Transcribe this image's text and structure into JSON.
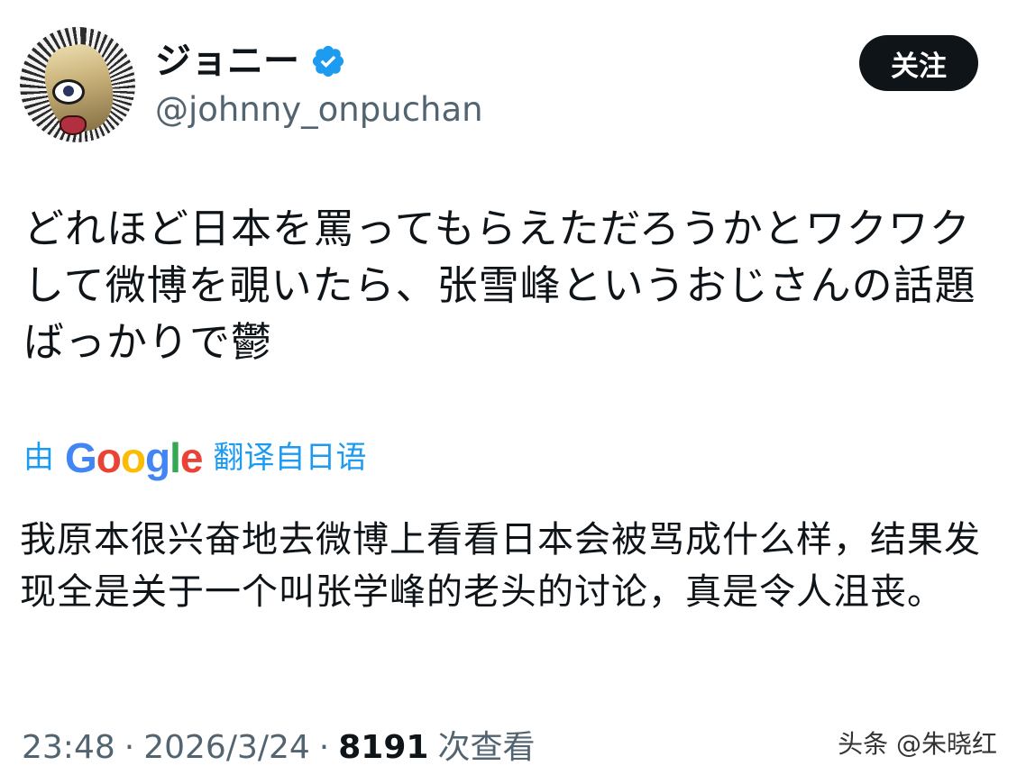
{
  "author": {
    "display_name": "ジョニー",
    "handle": "@johnny_onpuchan",
    "verified": true,
    "avatar": "avatar-image"
  },
  "follow_button": {
    "label": "关注"
  },
  "tweet": {
    "text": "どれほど日本を罵ってもらえただろうかとワクワクして微博を覗いたら、张雪峰というおじさんの話題ばっかりで鬱"
  },
  "translation": {
    "prefix": "由",
    "brand": "Google",
    "suffix": "翻译自日语",
    "text": "我原本很兴奋地去微博上看看日本会被骂成什么样，结果发现全是关于一个叫张学峰的老头的讨论，真是令人沮丧。"
  },
  "meta": {
    "time": "23:48",
    "separator": "·",
    "date": "2026/3/24",
    "views_count": "8191",
    "views_label": "次查看"
  },
  "watermark": {
    "text": "头条 @朱晓红"
  },
  "icons": {
    "verified": "verified-badge-icon"
  },
  "colors": {
    "accent": "#1d9bf0",
    "follow_bg": "#0f1419",
    "secondary_text": "#536471"
  }
}
